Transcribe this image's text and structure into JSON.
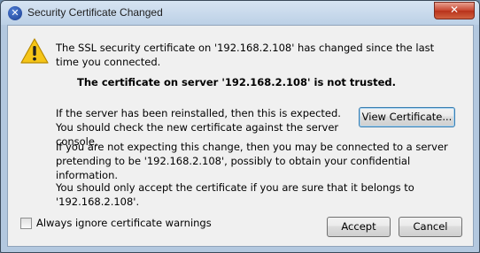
{
  "window": {
    "title": "Security Certificate Changed",
    "app_icon": "x-app-icon",
    "close_glyph": "✕"
  },
  "message": {
    "icon": "warning-icon",
    "line1": "The SSL security certificate on '192.168.2.108' has changed since the last time you connected.",
    "bold_line": "The certificate on server '192.168.2.108' is not trusted.",
    "reinstall_text": "If the server has been reinstalled, then this is expected.  You should check the new certificate against the server console.",
    "not_expecting_text": "If you are not expecting this change, then you may be connected to a server pretending to be '192.168.2.108', possibly to obtain your confidential information.",
    "accept_note": "You should only accept the certificate if you are sure that it belongs to '192.168.2.108'."
  },
  "buttons": {
    "view_certificate": "View Certificate...",
    "accept": "Accept",
    "cancel": "Cancel"
  },
  "checkbox": {
    "label": "Always ignore certificate warnings",
    "checked": false
  },
  "colors": {
    "warning_yellow": "#f5c518",
    "close_red": "#c7452f",
    "client_bg": "#f0f0f0"
  }
}
